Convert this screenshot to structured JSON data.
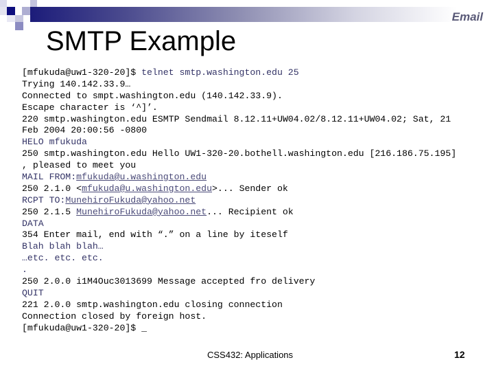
{
  "slide": {
    "section_label": "Email",
    "title": "SMTP Example",
    "footer_course": "CSS432: Applications",
    "page_number": "12"
  },
  "colors": {
    "header_gradient_start": "#1c1c7a",
    "user_command": "#333366",
    "server_response": "#000000",
    "link": "#4a4a78"
  },
  "terminal": {
    "lines": [
      {
        "parts": [
          {
            "text": "[mfukuda@uw1-320-20]$ ",
            "type": "out"
          },
          {
            "text": "telnet smtp.washington.edu 25",
            "type": "cmd"
          }
        ]
      },
      {
        "parts": [
          {
            "text": "Trying 140.142.33.9…",
            "type": "out"
          }
        ]
      },
      {
        "parts": [
          {
            "text": "Connected to smpt.washington.edu (140.142.33.9).",
            "type": "out"
          }
        ]
      },
      {
        "parts": [
          {
            "text": "Escape character is ‘^]’.",
            "type": "out"
          }
        ]
      },
      {
        "parts": [
          {
            "text": "220 smtp.washington.edu ESMTP Sendmail 8.12.11+UW04.02/8.12.11+UW04.02; Sat, 21",
            "type": "out"
          }
        ]
      },
      {
        "parts": [
          {
            "text": "Feb 2004 20:00:56 -0800",
            "type": "out"
          }
        ]
      },
      {
        "parts": [
          {
            "text": "HELO mfukuda",
            "type": "cmd"
          }
        ]
      },
      {
        "parts": [
          {
            "text": "250 smtp.washington.edu Hello UW1-320-20.bothell.washington.edu [216.186.75.195]",
            "type": "out"
          }
        ]
      },
      {
        "parts": [
          {
            "text": ", pleased to meet you",
            "type": "out"
          }
        ]
      },
      {
        "parts": [
          {
            "text": "MAIL FROM:",
            "type": "cmd"
          },
          {
            "text": "mfukuda@u.washington.edu",
            "type": "link"
          }
        ]
      },
      {
        "parts": [
          {
            "text": "250 2.1.0 <",
            "type": "out"
          },
          {
            "text": "mfukuda@u.washington.edu",
            "type": "link"
          },
          {
            "text": ">... Sender ok",
            "type": "out"
          }
        ]
      },
      {
        "parts": [
          {
            "text": "RCPT TO:",
            "type": "cmd"
          },
          {
            "text": "MunehiroFukuda@yahoo.net",
            "type": "link"
          }
        ]
      },
      {
        "parts": [
          {
            "text": "250 2.1.5 ",
            "type": "out"
          },
          {
            "text": "MunehiroFukuda@yahoo.net",
            "type": "link"
          },
          {
            "text": "... Recipient ok",
            "type": "out"
          }
        ]
      },
      {
        "parts": [
          {
            "text": "DATA",
            "type": "cmd"
          }
        ]
      },
      {
        "parts": [
          {
            "text": "354 Enter mail, end with “.” on a line by iteself",
            "type": "out"
          }
        ]
      },
      {
        "parts": [
          {
            "text": "Blah blah blah…",
            "type": "cmd"
          }
        ]
      },
      {
        "parts": [
          {
            "text": "…etc. etc. etc.",
            "type": "cmd"
          }
        ]
      },
      {
        "parts": [
          {
            "text": ".",
            "type": "cmd"
          }
        ]
      },
      {
        "parts": [
          {
            "text": "250 2.0.0 i1M4Ouc3013699 Message accepted fro delivery",
            "type": "out"
          }
        ]
      },
      {
        "parts": [
          {
            "text": "QUIT",
            "type": "cmd"
          }
        ]
      },
      {
        "parts": [
          {
            "text": "221 2.0.0 smtp.washington.edu closing connection",
            "type": "out"
          }
        ]
      },
      {
        "parts": [
          {
            "text": "Connection closed by foreign host.",
            "type": "out"
          }
        ]
      },
      {
        "parts": [
          {
            "text": "[mfukuda@uw1-320-20]$ _",
            "type": "out"
          }
        ]
      }
    ]
  }
}
